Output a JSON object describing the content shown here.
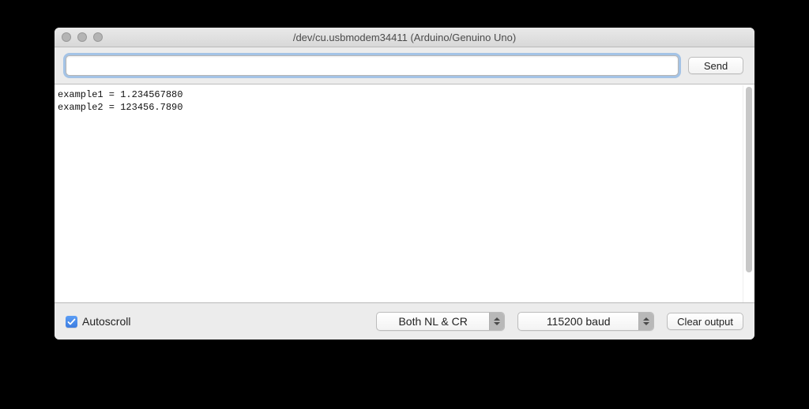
{
  "window": {
    "title": "/dev/cu.usbmodem34411 (Arduino/Genuino Uno)"
  },
  "toolbar": {
    "input_value": "",
    "send_label": "Send"
  },
  "output": {
    "lines": [
      "example1 = 1.234567880",
      "example2 = 123456.7890"
    ]
  },
  "footer": {
    "autoscroll_label": "Autoscroll",
    "autoscroll_checked": true,
    "line_ending_selected": "Both NL & CR",
    "baud_selected": "115200 baud",
    "clear_label": "Clear output"
  }
}
